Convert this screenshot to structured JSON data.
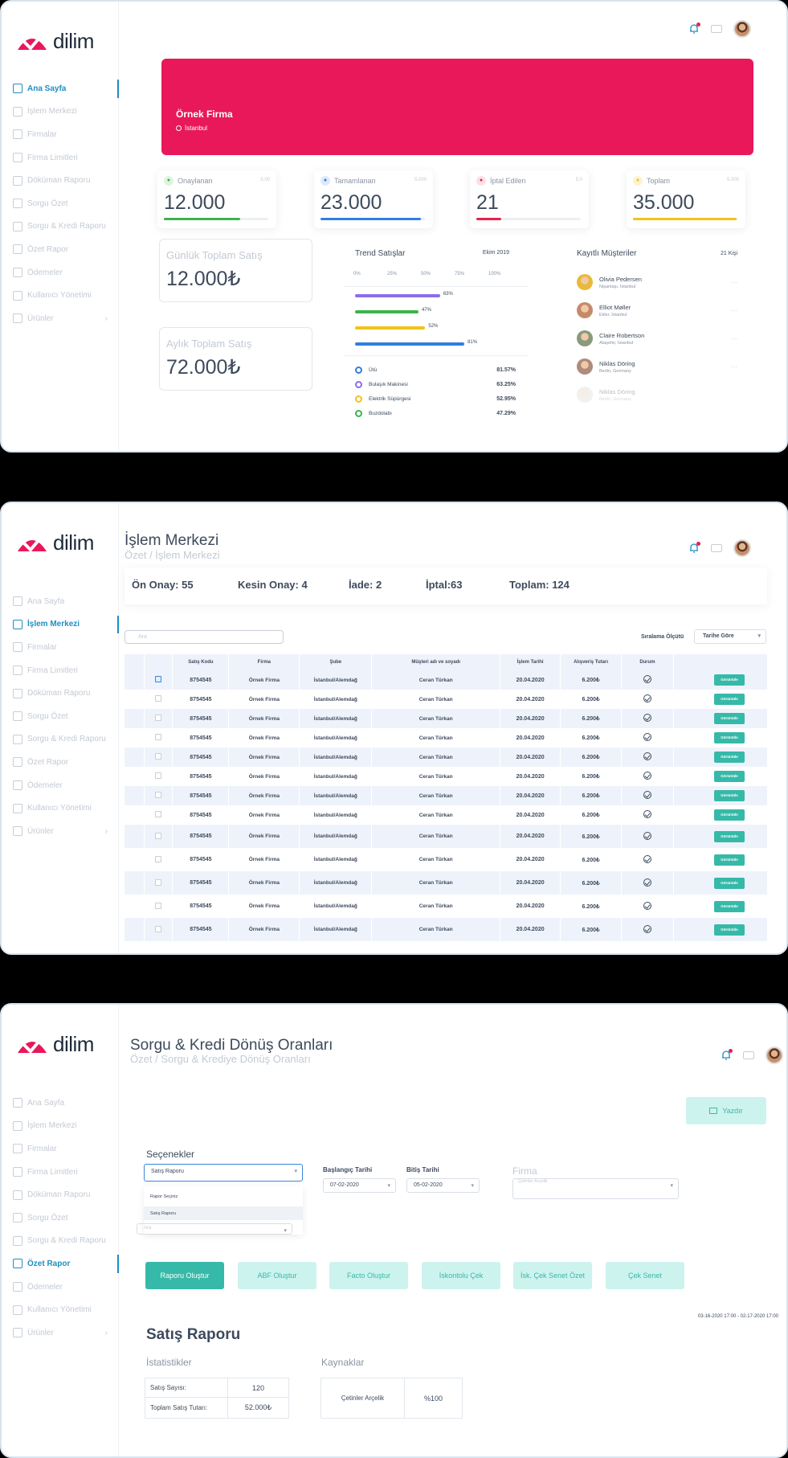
{
  "brand": {
    "name": "dilim",
    "color": "#e8185a",
    "accent": "#36b9a8",
    "active_color": "#1f8ec2"
  },
  "nav": [
    {
      "label": "Ana Sayfa",
      "icon": "grid-icon"
    },
    {
      "label": "İşlem Merkezi",
      "icon": "columns-icon"
    },
    {
      "label": "Firmalar",
      "icon": "building-icon"
    },
    {
      "label": "Firma Limitleri",
      "icon": "database-icon"
    },
    {
      "label": "Döküman Raporu",
      "icon": "document-icon"
    },
    {
      "label": "Sorgu Özet",
      "icon": "layers-icon"
    },
    {
      "label": "Sorgu & Kredi Raporu",
      "icon": "book-icon"
    },
    {
      "label": "Özet Rapor",
      "icon": "clipboard-icon"
    },
    {
      "label": "Ödemeler",
      "icon": "tag-icon"
    },
    {
      "label": "Kullanıcı Yönetimi",
      "icon": "users-icon"
    },
    {
      "label": "Ürünler",
      "icon": "box-icon"
    }
  ],
  "dashboard": {
    "hero": {
      "name": "Örnek Firma",
      "city": "İstanbul"
    },
    "stats": [
      {
        "label": "Onaylanan",
        "small": "5.00",
        "value": "12.000",
        "color": "#3cb44a",
        "badge_bg": "#dff3e1",
        "progress": 0.73,
        "icon": "check-icon"
      },
      {
        "label": "Tamamlanan",
        "small": "5.000",
        "value": "23.000",
        "color": "#2f7ee0",
        "badge_bg": "#dde9fb",
        "progress": 0.96,
        "icon": "thumb-up-icon"
      },
      {
        "label": "İptal Edilen",
        "small": "5.0",
        "value": "21",
        "color": "#e8214f",
        "badge_bg": "#fbe0e6",
        "progress": 0.24,
        "icon": "minus-circle-icon"
      },
      {
        "label": "Toplam",
        "small": "5.000",
        "value": "35.000",
        "color": "#f2c21b",
        "badge_bg": "#fdf3d1",
        "progress": 0.99,
        "icon": "plus-icon"
      }
    ],
    "daily": {
      "label": "Günlük Toplam Satış",
      "value": "12.000₺"
    },
    "monthly": {
      "label": "Aylık Toplam Satış",
      "value": "72.000₺"
    },
    "trend": {
      "title": "Trend Satışlar",
      "date": "Ekim 2019",
      "ticks": [
        "0%",
        "25%",
        "50%",
        "75%",
        "100%"
      ],
      "bars": [
        {
          "label": "63%",
          "value": 63,
          "color": "#8a6ee8"
        },
        {
          "label": "47%",
          "value": 47,
          "color": "#3cb44a"
        },
        {
          "label": "52%",
          "value": 52,
          "color": "#f2c21b"
        },
        {
          "label": "81%",
          "value": 81,
          "color": "#2f7ee0"
        }
      ],
      "legend": [
        {
          "name": "Ütü",
          "value": "81.57%",
          "color": "#2f7ee0"
        },
        {
          "name": "Bulaşık Makinesi",
          "value": "63.25%",
          "color": "#8a6ee8"
        },
        {
          "name": "Elektrik Süpürgesi",
          "value": "52.95%",
          "color": "#f2c21b"
        },
        {
          "name": "Buzdolabı",
          "value": "47.29%",
          "color": "#3cb44a"
        }
      ]
    },
    "customers": {
      "title": "Kayıtlı Müşteriler",
      "count": "21 Kişi",
      "list": [
        {
          "name": "Olivia Pedersen",
          "place": "Nişantaşı, İstanbul",
          "color": "#e8b93a"
        },
        {
          "name": "Elliot Møller",
          "place": "Etiler, İstanbul",
          "color": "#c58a6a"
        },
        {
          "name": "Claire Robertson",
          "place": "Ataşehir, İstanbul",
          "color": "#8a9a7a"
        },
        {
          "name": "Niklas Döring",
          "place": "Berlin, Germany",
          "color": "#b08a7a"
        },
        {
          "name": "Niklas Döring",
          "place": "Berlin, Germany",
          "color": "#d9d9d9"
        }
      ]
    }
  },
  "islem": {
    "title": "İşlem Merkezi",
    "breadcrumb": "Özet / İşlem Merkezi",
    "summary": {
      "on_onay": "Ön Onay: 55",
      "kesin_onay": "Kesin Onay: 4",
      "iade": "İade: 2",
      "iptal": "İptal:63",
      "toplam": "Toplam: 124"
    },
    "search_placeholder": "Ara",
    "sort_label": "Sıralama Ölçütü",
    "sort_value": "Tarihe Göre",
    "columns": [
      "",
      "Satış Kodu",
      "Firma",
      "Şube",
      "Müşteri adı ve soyadı",
      "İşlem Tarihi",
      "Alışveriş Tutarı",
      "Durum",
      ""
    ],
    "button_label": "Görüntüle",
    "rows": [
      {
        "checked": true,
        "code": "8754545",
        "firma": "Örnek Firma",
        "sube": "İstanbul/Alemdağ",
        "musteri": "Ceran Türkan",
        "tarih": "20.04.2020",
        "tutar": "6.200₺"
      },
      {
        "checked": false,
        "code": "8754545",
        "firma": "Örnek Firma",
        "sube": "İstanbul/Alemdağ",
        "musteri": "Ceran Türkan",
        "tarih": "20.04.2020",
        "tutar": "6.200₺"
      },
      {
        "checked": false,
        "code": "8754545",
        "firma": "Örnek Firma",
        "sube": "İstanbul/Alemdağ",
        "musteri": "Ceran Türkan",
        "tarih": "20.04.2020",
        "tutar": "6.200₺"
      },
      {
        "checked": false,
        "code": "8754545",
        "firma": "Örnek Firma",
        "sube": "İstanbul/Alemdağ",
        "musteri": "Ceran Türkan",
        "tarih": "20.04.2020",
        "tutar": "6.200₺"
      },
      {
        "checked": false,
        "code": "8754545",
        "firma": "Örnek Firma",
        "sube": "İstanbul/Alemdağ",
        "musteri": "Ceran Türkan",
        "tarih": "20.04.2020",
        "tutar": "6.200₺"
      },
      {
        "checked": false,
        "code": "8754545",
        "firma": "Örnek Firma",
        "sube": "İstanbul/Alemdağ",
        "musteri": "Ceran Türkan",
        "tarih": "20.04.2020",
        "tutar": "6.200₺"
      },
      {
        "checked": false,
        "code": "8754545",
        "firma": "Örnek Firma",
        "sube": "İstanbul/Alemdağ",
        "musteri": "Ceran Türkan",
        "tarih": "20.04.2020",
        "tutar": "6.200₺"
      },
      {
        "checked": false,
        "code": "8754545",
        "firma": "Örnek Firma",
        "sube": "İstanbul/Alemdağ",
        "musteri": "Ceran Türkan",
        "tarih": "20.04.2020",
        "tutar": "6.200₺"
      },
      {
        "checked": false,
        "code": "8754545",
        "firma": "Örnek Firma",
        "sube": "İstanbul/Alemdağ",
        "musteri": "Ceran Türkan",
        "tarih": "20.04.2020",
        "tutar": "6.200₺"
      },
      {
        "checked": false,
        "code": "8754545",
        "firma": "Örnek Firma",
        "sube": "İstanbul/Alemdağ",
        "musteri": "Ceran Türkan",
        "tarih": "20.04.2020",
        "tutar": "6.200₺"
      },
      {
        "checked": false,
        "code": "8754545",
        "firma": "Örnek Firma",
        "sube": "İstanbul/Alemdağ",
        "musteri": "Ceran Türkan",
        "tarih": "20.04.2020",
        "tutar": "6.200₺"
      },
      {
        "checked": false,
        "code": "8754545",
        "firma": "Örnek Firma",
        "sube": "İstanbul/Alemdağ",
        "musteri": "Ceran Türkan",
        "tarih": "20.04.2020",
        "tutar": "6.200₺"
      },
      {
        "checked": false,
        "code": "8754545",
        "firma": "Örnek Firma",
        "sube": "İstanbul/Alemdağ",
        "musteri": "Ceran Türkan",
        "tarih": "20.04.2020",
        "tutar": "6.200₺"
      }
    ]
  },
  "sorgu": {
    "title": "Sorgu & Kredi Dönüş Oranları",
    "breadcrumb": "Özet / Sorgu & Krediye Dönüş Oranları",
    "print_label": "Yazdır",
    "options_title": "Seçenekler",
    "report_select": "Satış Raporu",
    "dropdown": [
      "Rapor Seçiniz",
      "Satış Raporu"
    ],
    "search_placeholder": "Ara",
    "start_label": "Başlangıç Tarihi",
    "start_value": "07-02-2020",
    "end_label": "Bitiş Tarihi",
    "end_value": "05-02-2020",
    "firma_label": "Firma",
    "firma_value": "Çetinler Arçelik",
    "buttons": [
      "Raporu Oluştur",
      "ABF Oluştur",
      "Facto Oluştur",
      "İskontolu Çek",
      "İsk. Çek Senet Özet",
      "Çek Senet"
    ],
    "range": "03-16-2020 17:00 - 02-17-2020 17:00",
    "report_title": "Satış Raporu",
    "stats_title": "İstatistikler",
    "stats": [
      {
        "k": "Satış Sayısı:",
        "v": "120"
      },
      {
        "k": "Toplam Satış Tutarı:",
        "v": "52.000₺"
      }
    ],
    "sources_title": "Kaynaklar",
    "sources": [
      {
        "k": "Çetinler Arçelik",
        "v": "%100"
      }
    ]
  }
}
